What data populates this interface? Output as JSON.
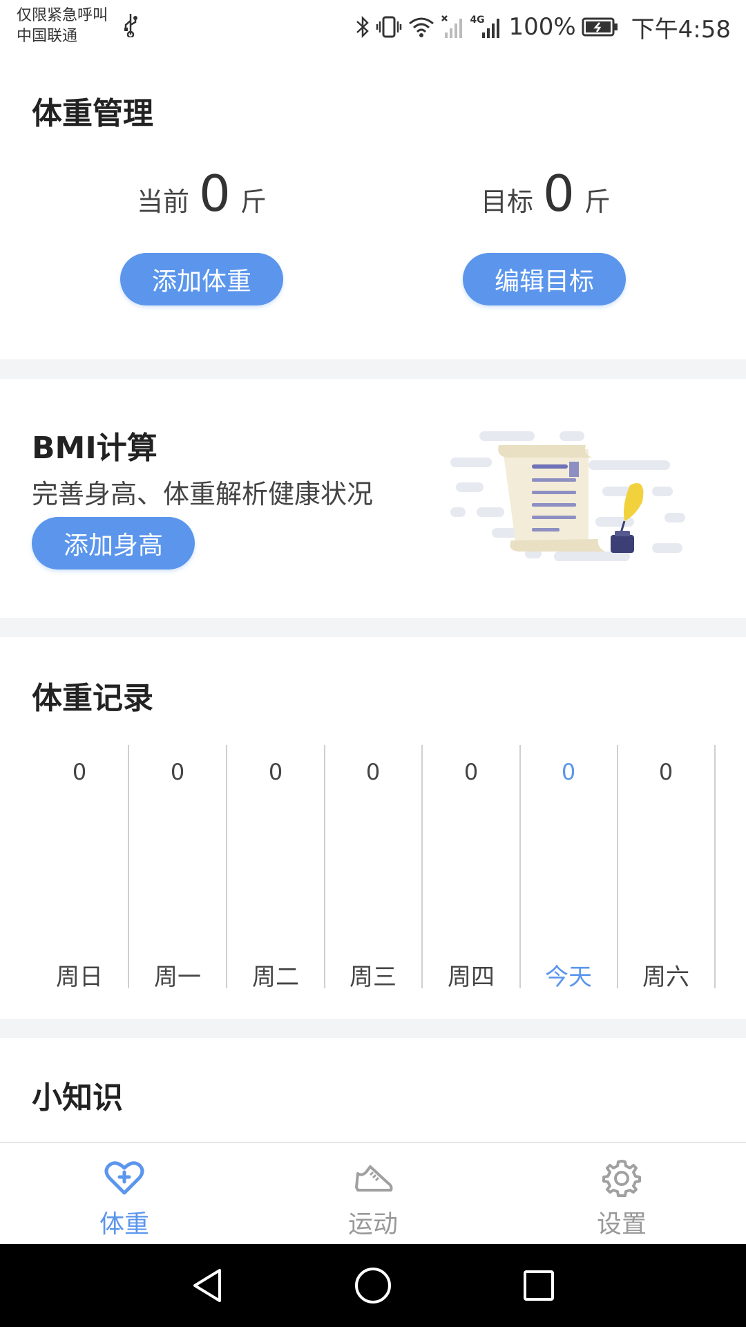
{
  "status_bar": {
    "line1": "仅限紧急呼叫",
    "line2": "中国联通",
    "network_tag": "4G",
    "battery": "100%",
    "time": "下午4:58"
  },
  "weight": {
    "title": "体重管理",
    "current_label": "当前",
    "current_value": "0",
    "current_unit": "斤",
    "target_label": "目标",
    "target_value": "0",
    "target_unit": "斤",
    "add_weight_button": "添加体重",
    "edit_target_button": "编辑目标"
  },
  "bmi": {
    "title": "BMI计算",
    "description": "完善身高、体重解析健康状况",
    "add_height_button": "添加身高"
  },
  "records": {
    "title": "体重记录",
    "days": [
      {
        "value": "0",
        "label": "周日"
      },
      {
        "value": "0",
        "label": "周一"
      },
      {
        "value": "0",
        "label": "周二"
      },
      {
        "value": "0",
        "label": "周三"
      },
      {
        "value": "0",
        "label": "周四"
      },
      {
        "value": "0",
        "label": "今天"
      },
      {
        "value": "0",
        "label": "周六"
      }
    ]
  },
  "tips": {
    "title": "小知识"
  },
  "bottom_nav": {
    "items": [
      {
        "label": "体重",
        "icon": "heart-plus-icon"
      },
      {
        "label": "运动",
        "icon": "sneaker-icon"
      },
      {
        "label": "设置",
        "icon": "gear-icon"
      }
    ]
  },
  "colors": {
    "accent": "#5b96ec",
    "divider": "#f3f4f6"
  }
}
